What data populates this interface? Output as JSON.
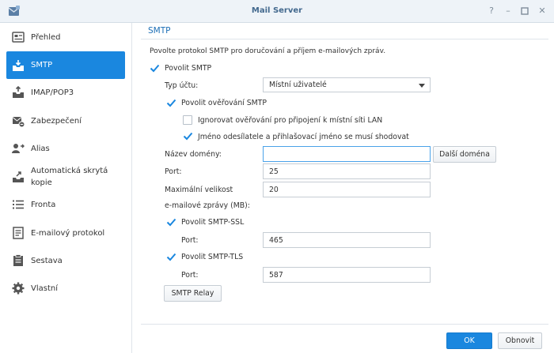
{
  "window": {
    "title": "Mail Server"
  },
  "sidebar": {
    "items": [
      {
        "label": "Přehled",
        "icon": "overview-icon"
      },
      {
        "label": "SMTP",
        "icon": "smtp-icon",
        "active": true
      },
      {
        "label": "IMAP/POP3",
        "icon": "imap-icon"
      },
      {
        "label": "Zabezpečení",
        "icon": "security-icon"
      },
      {
        "label": "Alias",
        "icon": "alias-icon"
      },
      {
        "label": "Automatická skrytá kopie",
        "icon": "auto-bcc-icon"
      },
      {
        "label": "Fronta",
        "icon": "queue-icon"
      },
      {
        "label": "E-mailový protokol",
        "icon": "mail-log-icon"
      },
      {
        "label": "Sestava",
        "icon": "report-icon"
      },
      {
        "label": "Vlastní",
        "icon": "custom-icon"
      }
    ]
  },
  "main": {
    "section_title": "SMTP",
    "description": "Povolte protokol SMTP pro doručování a příjem e-mailových zpráv.",
    "enable_smtp": {
      "label": "Povolit SMTP",
      "checked": true
    },
    "account_type": {
      "label": "Typ účtu:",
      "value": "Místní uživatelé"
    },
    "smtp_auth": {
      "label": "Povolit ověřování SMTP",
      "checked": true
    },
    "ignore_lan": {
      "label": "Ignorovat ověřování pro připojení k místní síti LAN",
      "checked": false
    },
    "sender_match": {
      "label": "Jméno odesílatele a přihlašovací jméno se musí shodovat",
      "checked": true
    },
    "domain": {
      "label": "Název domény:",
      "value": "",
      "button": "Další doména"
    },
    "port": {
      "label": "Port:",
      "value": "25"
    },
    "max_size": {
      "label_line1": "Maximální velikost",
      "label_line2": "e-mailové zprávy (MB):",
      "value": "20"
    },
    "smtp_ssl": {
      "label": "Povolit SMTP-SSL",
      "checked": true,
      "port_label": "Port:",
      "port_value": "465"
    },
    "smtp_tls": {
      "label": "Povolit SMTP-TLS",
      "checked": true,
      "port_label": "Port:",
      "port_value": "587"
    },
    "relay_button": "SMTP Relay"
  },
  "footer": {
    "ok_label": "OK",
    "reset_label": "Obnovit"
  },
  "colors": {
    "accent": "#1a87df",
    "title": "#43698e",
    "section": "#1d6fb6"
  }
}
